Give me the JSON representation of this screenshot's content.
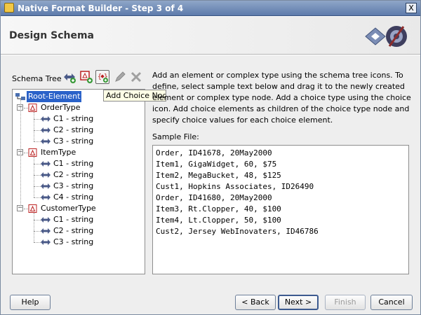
{
  "window": {
    "title": "Native Format Builder - Step 3 of 4",
    "close_label": "X"
  },
  "header": {
    "title": "Design Schema"
  },
  "toolbar": {
    "label": "Schema Tree",
    "tooltip": "Add Choice Node",
    "icons": [
      "add-element-icon",
      "add-complex-type-icon",
      "add-choice-icon",
      "edit-icon",
      "delete-icon"
    ]
  },
  "tree": {
    "root": "Root-Element",
    "nodes": [
      {
        "label": "OrderType",
        "children": [
          "C1 - string",
          "C2 - string",
          "C3 - string"
        ]
      },
      {
        "label": "ItemType",
        "children": [
          "C1 - string",
          "C2 - string",
          "C3 - string",
          "C4 - string"
        ]
      },
      {
        "label": "CustomerType",
        "children": [
          "C1 - string",
          "C2 - string",
          "C3 - string"
        ]
      }
    ]
  },
  "description": "Add an element or complex type using the schema tree icons. To define, select sample text below and drag it to the newly created element or complex type node. Add a choice type using the choice icon. Add choice elements as children of the choice type node and specify choice values for each choice element.",
  "sample": {
    "label": "Sample File:",
    "lines": [
      "Order, ID41678, 20May2000",
      "Item1, GigaWidget, 60, $75",
      "Item2, MegaBucket, 48, $125",
      "Cust1, Hopkins Associates, ID26490",
      "Order, ID41680, 20May2000",
      "Item3, Rt.Clopper, 40, $100",
      "Item4, Lt.Clopper, 50, $100",
      "Cust2, Jersey WebInovaters, ID46786"
    ]
  },
  "buttons": {
    "help": "Help",
    "back": "< Back",
    "next": "Next >",
    "finish": "Finish",
    "cancel": "Cancel"
  }
}
